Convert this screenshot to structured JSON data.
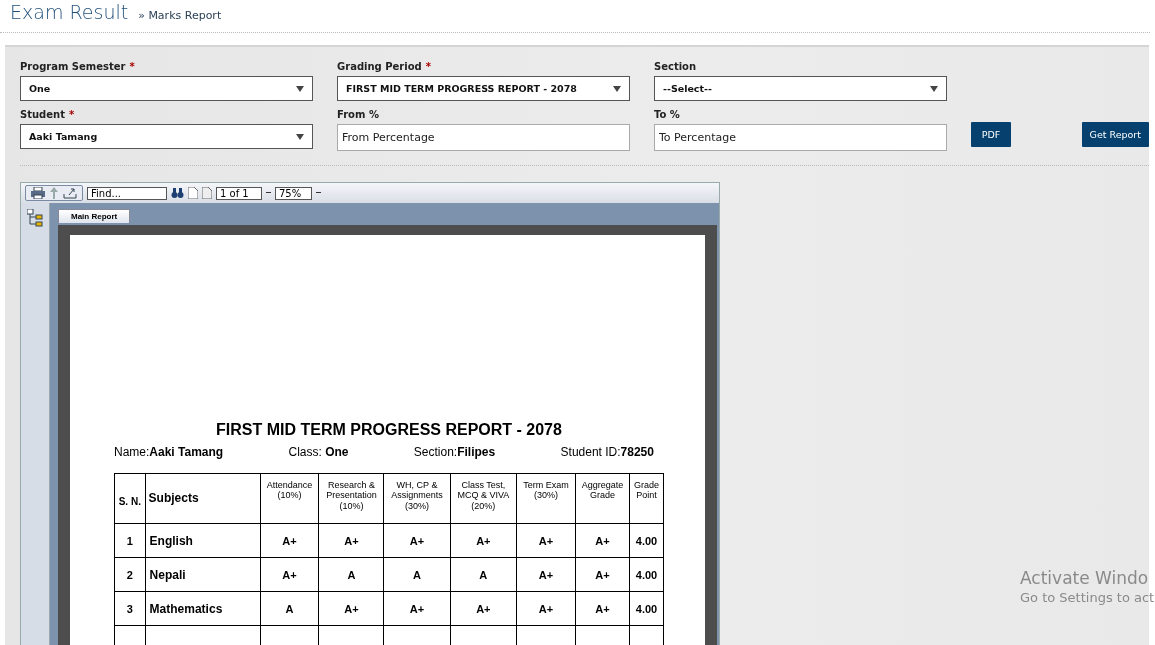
{
  "header": {
    "title": "Exam Result",
    "breadcrumb": "» Marks Report"
  },
  "form": {
    "fields": [
      {
        "kind": "select",
        "label": "Program Semester",
        "required_mark": "*",
        "value": "One"
      },
      {
        "kind": "select",
        "label": "Grading Period",
        "required_mark": "*",
        "value": "FIRST MID TERM PROGRESS REPORT - 2078"
      },
      {
        "kind": "select",
        "label": "Section",
        "value": "--Select--"
      },
      {
        "kind": "select",
        "label": "Student",
        "required_mark": "*",
        "value": "Aaki Tamang"
      },
      {
        "kind": "input",
        "label": "From %",
        "placeholder": "From Percentage"
      },
      {
        "kind": "input",
        "label": "To %",
        "placeholder": "To Percentage"
      }
    ],
    "buttons": [
      "PDF",
      "Get Report"
    ]
  },
  "viewer": {
    "find_placeholder": "Find...",
    "page": "1 of 1",
    "zoom": "75%",
    "tab": "Main Report",
    "report": {
      "title": "FIRST MID TERM PROGRESS REPORT - 2078",
      "info": [
        {
          "label": "Name:",
          "value": "Aaki  Tamang"
        },
        {
          "label": "Class: ",
          "value": "One"
        },
        {
          "label": "Section:",
          "value": "Filipes"
        },
        {
          "label": "Student ID:",
          "value": "78250"
        }
      ],
      "columns": [
        "S. N.",
        "Subjects",
        "Attendance\n(10%)",
        "Research &\nPresentation\n(10%)",
        "WH, CP &\nAssignments\n(30%)",
        "Class Test,\nMCQ & VIVA\n(20%)",
        "Term Exam\n(30%)",
        "Aggregate\nGrade",
        "Grade\nPoint"
      ],
      "rows": [
        [
          "1",
          "English",
          "A+",
          "A+",
          "A+",
          "A+",
          "A+",
          "A+",
          "4.00"
        ],
        [
          "2",
          "Nepali",
          "A+",
          "A",
          "A",
          "A",
          "A+",
          "A+",
          "4.00"
        ],
        [
          "3",
          "Mathematics",
          "A",
          "A+",
          "A+",
          "A+",
          "A+",
          "A+",
          "4.00"
        ]
      ]
    }
  },
  "os_notice": {
    "title": "Activate Windo",
    "text": "Go to Settings to act"
  }
}
